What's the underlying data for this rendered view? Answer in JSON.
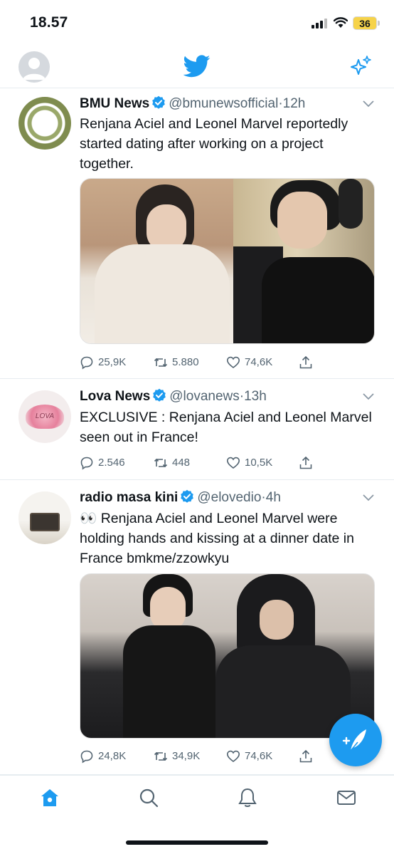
{
  "status_bar": {
    "time": "18.57",
    "battery": "36",
    "battery_color": "#f6d34a"
  },
  "header": {
    "logo_icon": "twitter-bird-icon",
    "sparkle_icon": "sparkle-icon",
    "accent": "#1d9bf0"
  },
  "tweets": [
    {
      "name": "BMU News",
      "verified": true,
      "handle": "@bmunewsofficial",
      "separator": "·",
      "time": "12h",
      "text": "Renjana Aciel and Leonel Marvel reportedly started dating after working on a project together.",
      "media": "two-photo collage",
      "replies": "25,9K",
      "retweets": "5.880",
      "likes": "74,6K"
    },
    {
      "name": "Lova News",
      "verified": true,
      "handle": "@lovanews",
      "separator": "·",
      "time": "13h",
      "avatar_text": "LOVA",
      "text": "EXCLUSIVE : Renjana Aciel and Leonel Marvel seen out in France!",
      "replies": "2.546",
      "retweets": "448",
      "likes": "10,5K"
    },
    {
      "name": "radio masa kini",
      "verified": true,
      "handle": "@elovedio",
      "separator": "·",
      "time": "4h",
      "text": "👀 Renjana Aciel and Leonel Marvel were holding hands and kissing at a dinner date in France bmkme/zzowkyu",
      "media": "photo",
      "replies": "24,8K",
      "retweets": "34,9K",
      "likes": "74,6K"
    }
  ],
  "bottom_nav": [
    "home-icon",
    "search-icon",
    "notifications-icon",
    "messages-icon"
  ],
  "fab_icon": "compose-icon"
}
